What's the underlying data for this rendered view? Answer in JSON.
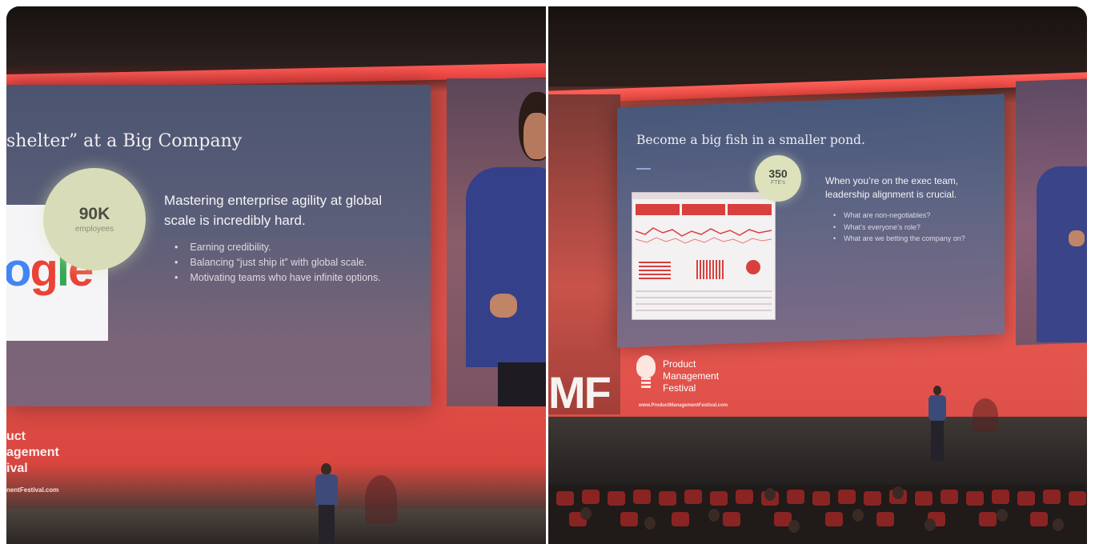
{
  "left_photo": {
    "slide": {
      "title": "shelter” at a Big Company",
      "logo_text": "ogle",
      "stat": {
        "number": "90K",
        "label": "employees"
      },
      "heading": "Mastering enterprise agility at global scale is incredibly hard.",
      "bullets": [
        "Earning credibility.",
        "Balancing “just ship it” with global scale.",
        "Motivating teams who have infinite options."
      ]
    },
    "banner": {
      "lines": [
        "uct",
        "agement",
        "ival"
      ],
      "url": "nentFestival.com"
    }
  },
  "right_photo": {
    "slide": {
      "title": "Become a big fish in a smaller pond.",
      "stat": {
        "number": "350",
        "label": "FTE's"
      },
      "heading": "When you’re on the exec team, leadership alignment is crucial.",
      "bullets": [
        "What are non-negotiables?",
        "What’s everyone’s role?",
        "What are we betting the company on?"
      ]
    },
    "banner": {
      "lines": [
        "Product",
        "Management",
        "Festival"
      ],
      "url": "www.ProductManagementFestival.com",
      "logo_letters": "MF"
    }
  },
  "colors": {
    "stage_red": "#e5544d",
    "slide_blue": "#4b5470",
    "stat_circle": "#d9dcb8"
  }
}
